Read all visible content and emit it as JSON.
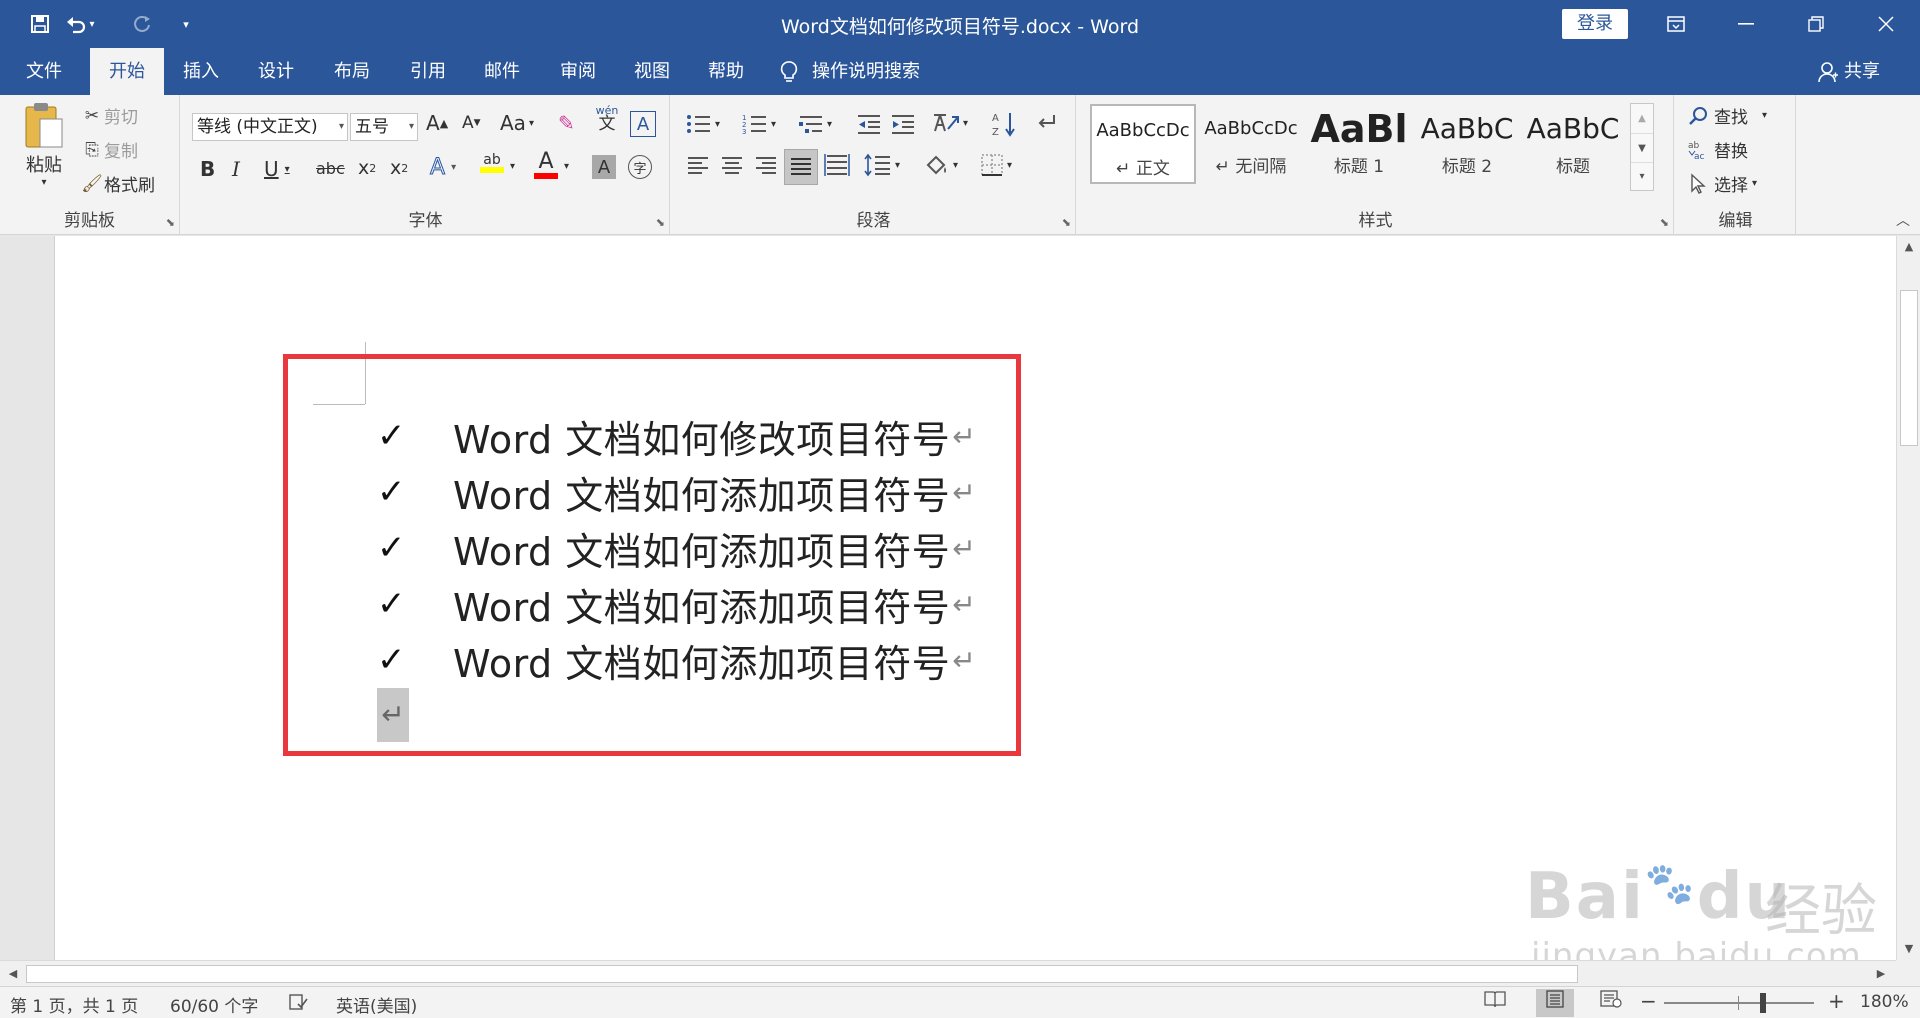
{
  "quick_access": {
    "save_icon": "save-icon",
    "undo_icon": "undo-icon",
    "redo_icon": "redo-icon",
    "customize_icon": "customize-qat-icon"
  },
  "window": {
    "title": "Word文档如何修改项目符号.docx  -  Word",
    "login_label": "登录",
    "ribbon_display_icon": "ribbon-display-options-icon",
    "minimize_icon": "minimize-icon",
    "restore_icon": "restore-icon",
    "close_icon": "close-icon"
  },
  "tabs": [
    {
      "label": "文件"
    },
    {
      "label": "开始"
    },
    {
      "label": "插入"
    },
    {
      "label": "设计"
    },
    {
      "label": "布局"
    },
    {
      "label": "引用"
    },
    {
      "label": "邮件"
    },
    {
      "label": "审阅"
    },
    {
      "label": "视图"
    },
    {
      "label": "帮助"
    }
  ],
  "active_tab": "开始",
  "tell_me": {
    "label": "操作说明搜索"
  },
  "share": {
    "label": "共享"
  },
  "clipboard": {
    "label": "剪贴板",
    "paste": "粘贴",
    "cut": "剪切",
    "copy": "复制",
    "format_painter": "格式刷"
  },
  "font": {
    "label": "字体",
    "font_name": "等线 (中文正文)",
    "font_size": "五号",
    "grow": "A",
    "shrink": "A",
    "change_case": "Aa",
    "phonetic_top": "wén",
    "phonetic_bottom": "文",
    "bold": "B",
    "italic": "I",
    "underline": "U",
    "strikethrough": "abc",
    "subscript": "x",
    "subscript_num": "2",
    "superscript": "x",
    "superscript_num": "2",
    "text_effects": "A",
    "highlight": "ab",
    "font_color": "A",
    "char_shading": "A",
    "enclose": "字",
    "border_char": "A",
    "highlight_color": "#ffff00",
    "font_color_value": "#ff0000"
  },
  "paragraph": {
    "label": "段落"
  },
  "styles": {
    "label": "样式",
    "items": [
      {
        "sample": "AaBbCcDc",
        "name": "正文"
      },
      {
        "sample": "AaBbCcDc",
        "name": "无间隔"
      },
      {
        "sample": "AaBl",
        "name": "标题 1"
      },
      {
        "sample": "AaBbC",
        "name": "标题 2"
      },
      {
        "sample": "AaBbC",
        "name": "标题"
      }
    ]
  },
  "editing": {
    "label": "编辑",
    "find": "查找",
    "replace": "替换",
    "select": "选择"
  },
  "document": {
    "bullet_symbol": "✓",
    "paragraph_mark": "↵",
    "items": [
      {
        "text": "Word 文档如何修改项目符号"
      },
      {
        "text": "Word 文档如何添加项目符号"
      },
      {
        "text": "Word 文档如何添加项目符号"
      },
      {
        "text": "Word 文档如何添加项目符号"
      },
      {
        "text": "Word 文档如何添加项目符号"
      }
    ],
    "highlight_box_color": "#e8383d"
  },
  "watermark": {
    "brand": "Bai",
    "brand2": "du",
    "cn": "经验",
    "url": "jingyan.baidu.com"
  },
  "status": {
    "page": "第 1 页，共 1 页",
    "words": "60/60 个字",
    "language": "英语(美国)",
    "zoom": "180%",
    "zoom_minus": "−",
    "zoom_plus": "+"
  },
  "theme": {
    "brand": "#2b579a"
  }
}
